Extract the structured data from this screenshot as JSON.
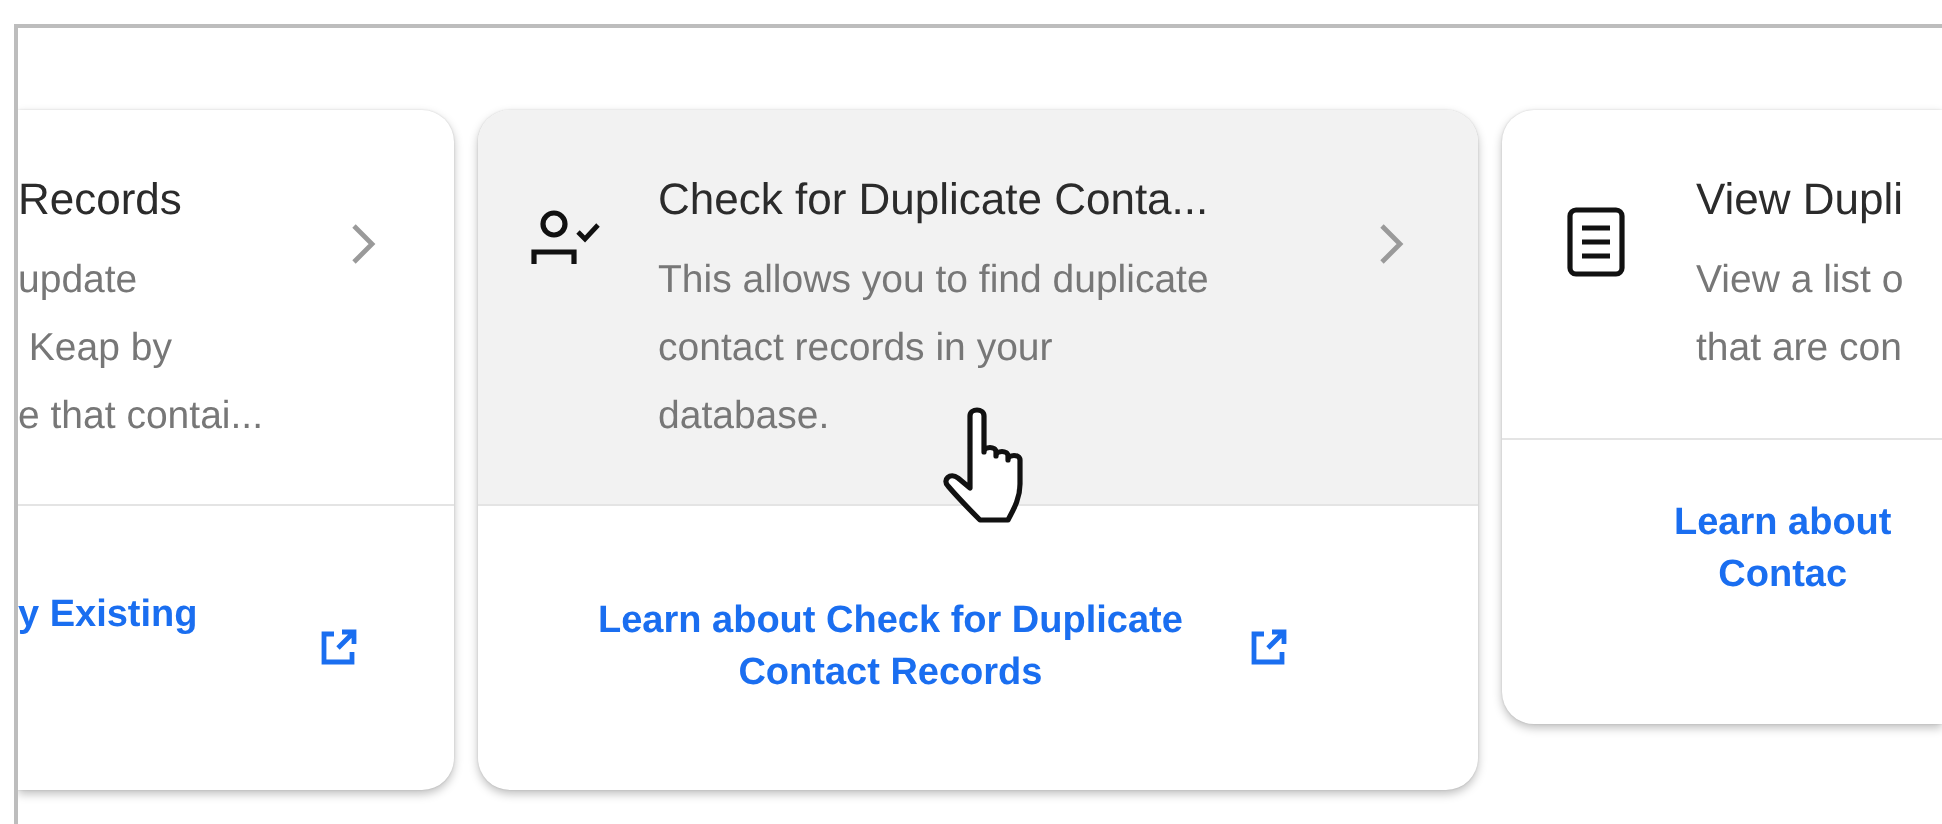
{
  "cards": [
    {
      "kind": "clipped-left",
      "hovered": false,
      "title": "Records",
      "description_lines": [
        "update",
        " Keap by",
        "e that contai..."
      ],
      "link_lines": [
        "y Existing"
      ]
    },
    {
      "kind": "full",
      "hovered": true,
      "title": "Check for Duplicate Conta...",
      "description_lines": [
        "This allows you to find duplicate",
        "contact records in your",
        "database."
      ],
      "link_lines": [
        "Learn about Check for Duplicate",
        "Contact Records"
      ]
    },
    {
      "kind": "clipped-right",
      "hovered": false,
      "title": "View Dupli",
      "description_lines": [
        "View a list o",
        "that are con"
      ],
      "link_lines": [
        "Learn about",
        "Contac"
      ]
    }
  ]
}
